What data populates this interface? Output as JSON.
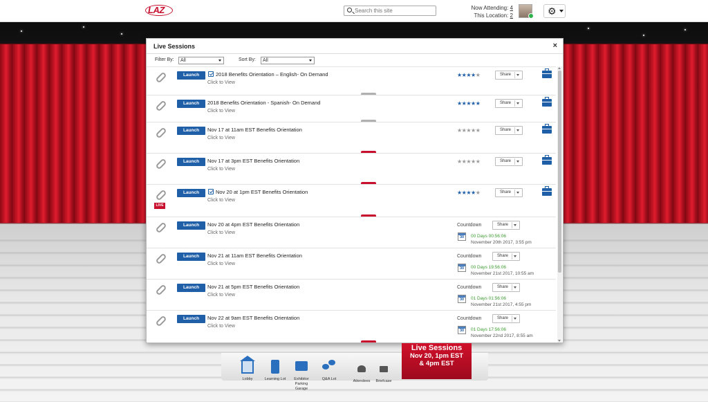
{
  "header": {
    "logo_text": "LAZ",
    "search_placeholder": "Search this site",
    "now_attending_label": "Now Attending:",
    "now_attending_count": "4",
    "this_location_label": "This Location:",
    "this_location_count": "2"
  },
  "modal": {
    "title": "Live Sessions",
    "close": "×",
    "filter_label": "Filter By:",
    "filter_value": "All",
    "sort_label": "Sort By:",
    "sort_value": "All"
  },
  "launch_label": "Launch",
  "click_to_view": "Click to View",
  "share_label": "Share",
  "countdown_label": "Countdown",
  "live_badge": "LIVE",
  "sessions": [
    {
      "title": "2018 Benefits Orientation – English- On Demand",
      "checked": true,
      "rating": 4
    },
    {
      "title": "2018 Benefits Orientation - Spanish- On Demand",
      "checked": false,
      "rating": 5
    },
    {
      "title": "Nov 17 at 11am EST Benefits Orientation",
      "checked": false,
      "rating": 0
    },
    {
      "title": "Nov 17 at 3pm EST Benefits Orientation",
      "checked": false,
      "rating": 0
    },
    {
      "title": "Nov 20 at 1pm EST Benefits Orientation",
      "checked": true,
      "rating": 4,
      "live": true
    },
    {
      "title": "Nov 20 at 4pm EST Benefits Orientation",
      "countdown": "00 Days 00:56:06",
      "date": "November 20th 2017, 3:55 pm"
    },
    {
      "title": "Nov 21 at 11am EST Benefits Orientation",
      "countdown": "00 Days 19:56:06",
      "date": "November 21st 2017, 10:55 am"
    },
    {
      "title": "Nov 21 at 5pm EST Benefits Orientation",
      "countdown": "01 Days 01:56:06",
      "date": "November 21st 2017, 4:55 pm"
    },
    {
      "title": "Nov 22 at 9am EST Benefits Orientation",
      "countdown": "01 Days 17:56:06",
      "date": "November 22nd 2017, 8:55 am"
    }
  ],
  "calendar_day": "30",
  "nav": {
    "lobby": "Lobby",
    "learning_lot": "Learning Lot",
    "exhibitor_line1": "Exhibitor",
    "exhibitor_line2": "Parking",
    "exhibitor_line3": "Garage",
    "qa_lot": "Q&A Lot",
    "attendees": "Attendees",
    "briefcase": "Briefcase"
  },
  "live_banner": {
    "line1": "Live Sessions",
    "line2": "Nov 20, 1pm EST",
    "line3": "& 4pm EST"
  },
  "colors": {
    "brand_red": "#c8102e",
    "launch_blue": "#1f5fa8",
    "countdown_green": "#3a9a2d"
  }
}
